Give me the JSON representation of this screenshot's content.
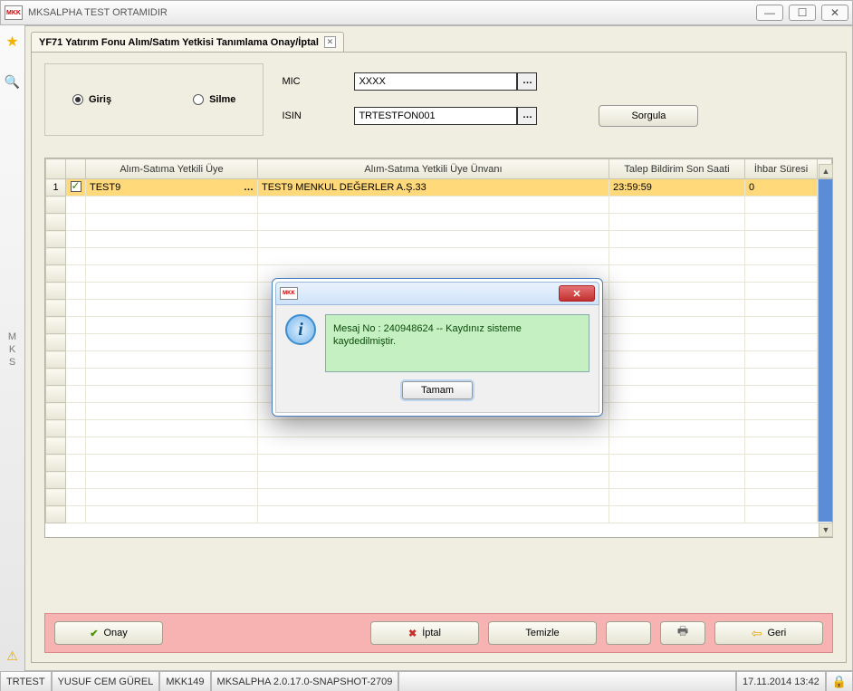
{
  "window": {
    "title": "MKSALPHA TEST ORTAMIDIR",
    "logo": "MKK"
  },
  "leftrail": {
    "mks": "M\nK\nS"
  },
  "tab": {
    "label": "YF71 Yatırım Fonu Alım/Satım Yetkisi Tanımlama Onay/İptal"
  },
  "criteria": {
    "radio_giris": "Giriş",
    "radio_silme": "Silme",
    "mic_label": "MIC",
    "mic_value": "XXXX",
    "isin_label": "ISIN",
    "isin_value": "TRTESTFON001",
    "sorgula": "Sorgula"
  },
  "grid": {
    "headers": {
      "uye": "Alım-Satıma Yetkili Üye",
      "unvan": "Alım-Satıma Yetkili Üye Ünvanı",
      "saat": "Talep Bildirim Son Saati",
      "ihbar": "İhbar Süresi"
    },
    "row0": {
      "num": "1",
      "uye": "TEST9",
      "unvan": "TEST9 MENKUL DEĞERLER A.Ş.33",
      "saat": "23:59:59",
      "ihbar": "0"
    }
  },
  "actions": {
    "onay": "Onay",
    "iptal": "İptal",
    "temizle": "Temizle",
    "geri": "Geri"
  },
  "status": {
    "s1": "TRTEST",
    "s2": "YUSUF CEM GÜREL",
    "s3": "MKK149",
    "s4": "MKSALPHA 2.0.17.0-SNAPSHOT-2709",
    "datetime": "17.11.2014 13:42"
  },
  "modal": {
    "logo": "MKK",
    "message": "Mesaj No : 240948624 -- Kaydınız sisteme kaydedilmiştir.",
    "ok": "Tamam"
  }
}
